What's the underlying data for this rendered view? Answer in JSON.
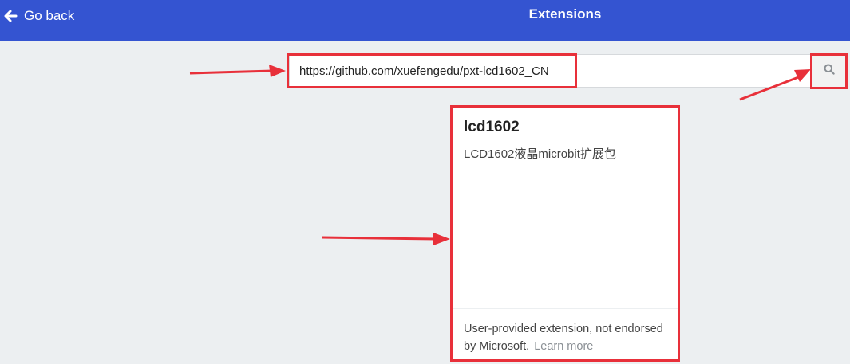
{
  "header": {
    "back_label": "Go back",
    "title": "Extensions"
  },
  "search": {
    "value": "https://github.com/xuefengedu/pxt-lcd1602_CN",
    "placeholder": ""
  },
  "result_card": {
    "name": "lcd1602",
    "description": "LCD1602液晶microbit扩展包",
    "footer_text": "User-provided extension, not endorsed by Microsoft.",
    "learn_more": "Learn more"
  },
  "colors": {
    "header_bg": "#3454d1",
    "page_bg": "#eceff1",
    "highlight": "#e8303a"
  },
  "icons": {
    "back": "arrow-left-icon",
    "search": "search-icon"
  }
}
